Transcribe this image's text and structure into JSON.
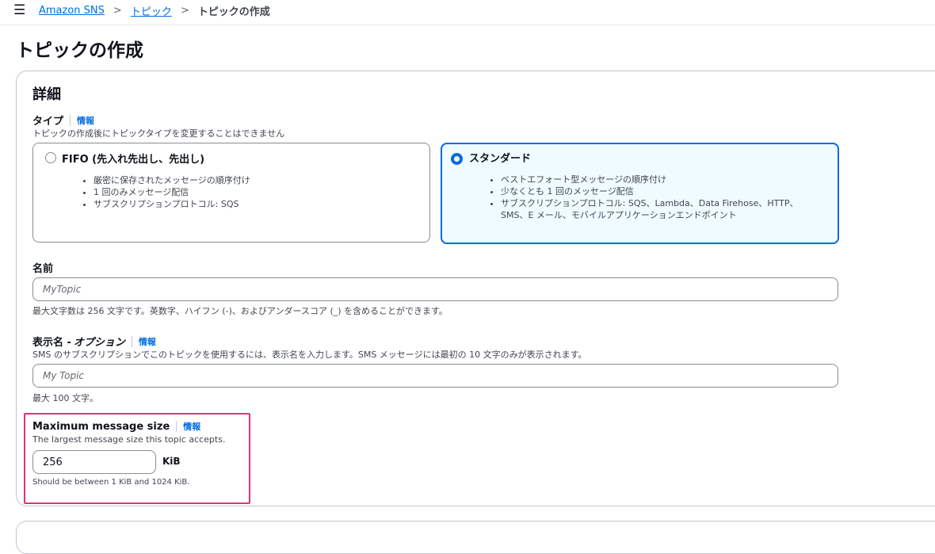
{
  "topbar": {
    "menu_icon": "hamburger-menu-icon",
    "breadcrumbs": [
      "Amazon SNS",
      "トピック",
      "トピックの作成"
    ]
  },
  "page_title": "トピックの作成",
  "details": {
    "title": "詳細",
    "type": {
      "label": "タイプ",
      "info": "情報",
      "description": "トピックの作成後にトピックタイプを変更することはできません",
      "options": [
        {
          "title": "FIFO (先入れ先出し、先出し)",
          "selected": false,
          "bullets": [
            "厳密に保存されたメッセージの順序付け",
            "1 回のみメッセージ配信",
            "サブスクリプションプロトコル: SQS"
          ]
        },
        {
          "title": "スタンダード",
          "selected": true,
          "bullets": [
            "ベストエフォート型メッセージの順序付け",
            "少なくとも 1 回のメッセージ配信",
            "サブスクリプションプロトコル: SQS、Lambda、Data Firehose、HTTP、",
            "SMS、E メール、モバイルアプリケーションエンドポイント"
          ]
        }
      ]
    },
    "name": {
      "label": "名前",
      "value": "",
      "placeholder": "MyTopic",
      "hint": "最大文字数は 256 文字です。英数字、ハイフン (-)、およびアンダースコア (_) を含めることができます。"
    },
    "display_name": {
      "label_main": "表示名 - ",
      "label_optional": "オプション",
      "info": "情報",
      "description": "SMS のサブスクリプションでこのトピックを使用するには、表示名を入力します。SMS メッセージには最初の 10 文字のみが表示されます。",
      "value": "",
      "placeholder": "My Topic",
      "hint": "最大 100 文字。"
    },
    "max_message_size": {
      "label": "Maximum message size",
      "info": "情報",
      "description": "The largest message size this topic accepts.",
      "value": "256",
      "unit": "KiB",
      "hint": "Should be between 1 KiB and 1024 KiB."
    }
  },
  "colors": {
    "link": "#006ce0",
    "selected_tile_bg": "#f0fbff",
    "highlight_border": "#e0317c"
  }
}
